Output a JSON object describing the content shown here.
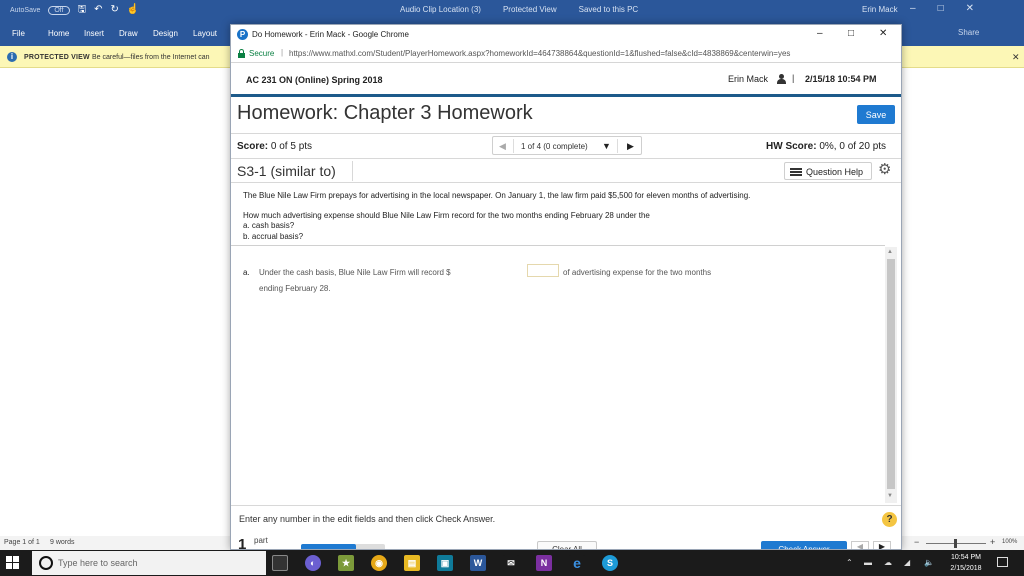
{
  "word": {
    "autosave_label": "AutoSave",
    "autosave_state": "Off",
    "title_items": [
      "Audio Clip Location (3)",
      "Protected View",
      "Saved to this PC"
    ],
    "user": "Erin Mack",
    "tabs": [
      "File",
      "Home",
      "Insert",
      "Draw",
      "Design",
      "Layout"
    ],
    "share": "Share",
    "protected_label": "PROTECTED VIEW",
    "protected_msg": "Be careful—files from the Internet can",
    "status_pages": "Page 1 of 1",
    "status_words": "9 words",
    "zoom": "100%"
  },
  "chrome": {
    "tab_title": "Do Homework - Erin Mack - Google Chrome",
    "secure_label": "Secure",
    "url": "https://www.mathxl.com/Student/PlayerHomework.aspx?homeworkId=464738864&questionId=1&flushed=false&cId=4838869&centerwin=yes"
  },
  "course": {
    "name": "AC 231 ON (Online) Spring 2018",
    "user": "Erin Mack",
    "datetime": "2/15/18 10:54 PM"
  },
  "homework": {
    "title": "Homework: Chapter 3 Homework",
    "save_label": "Save",
    "score_label": "Score:",
    "score_value": "0 of 5 pts",
    "pager_label": "1 of 4 (0 complete)",
    "hw_score_label": "HW Score:",
    "hw_score_value": "0%, 0 of 20 pts",
    "question_id": "S3-1 (similar to)",
    "question_help": "Question Help"
  },
  "problem": {
    "intro": "The Blue Nile Law Firm prepays for advertising in the local newspaper. On January 1, the law firm paid $5,500 for eleven months of advertising.",
    "ask": "How much advertising expense should Blue Nile Law Firm record for the two months ending February 28 under the",
    "part_a": "a. cash basis?",
    "part_b": "b. accrual basis?"
  },
  "answer": {
    "letter": "a.",
    "text_before": "Under the cash basis, Blue Nile Law Firm will record $",
    "text_after": "of advertising expense for the two months",
    "text_line2": "ending February 28.",
    "field_value": ""
  },
  "footer": {
    "instructions": "Enter any number in the edit fields and then click Check Answer.",
    "part_num": "1",
    "part_label": "part",
    "progress_fraction": 0.65,
    "clear_all": "Clear All",
    "check_answer": "Check Answer"
  },
  "taskbar": {
    "search_placeholder": "Type here to search",
    "time": "10:54 PM",
    "date": "2/15/2018"
  },
  "colors": {
    "word_blue": "#2b579a",
    "mylab_blue": "#1f7ad1",
    "header_rule": "#1d5a8a",
    "protected_yellow": "#fcf7b6",
    "help_yellow": "#f4c542"
  }
}
